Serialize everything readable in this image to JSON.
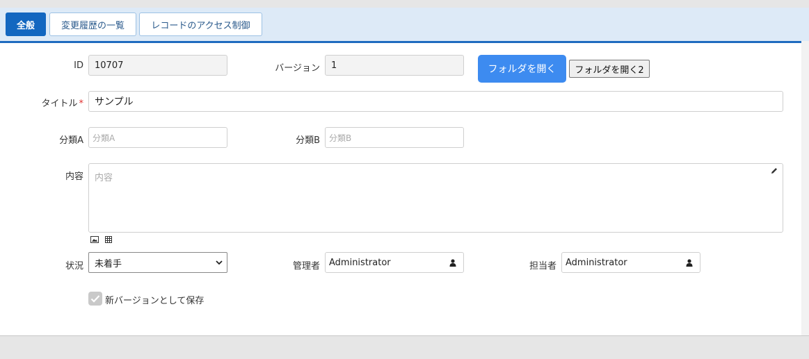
{
  "tabs": [
    {
      "label": "全般",
      "active": true
    },
    {
      "label": "変更履歴の一覧",
      "active": false
    },
    {
      "label": "レコードのアクセス制御",
      "active": false
    }
  ],
  "form": {
    "id": {
      "label": "ID",
      "value": "10707"
    },
    "version": {
      "label": "バージョン",
      "value": "1"
    },
    "open_folder_button": "フォルダを開く",
    "open_folder_button2": "フォルダを開く2",
    "title": {
      "label": "タイトル",
      "required_mark": "*",
      "value": "サンプル"
    },
    "class_a": {
      "label": "分類A",
      "placeholder": "分類A"
    },
    "class_b": {
      "label": "分類B",
      "placeholder": "分類B"
    },
    "body": {
      "label": "内容",
      "placeholder": "内容"
    },
    "status": {
      "label": "状況",
      "value": "未着手"
    },
    "manager": {
      "label": "管理者",
      "value": "Administrator"
    },
    "owner": {
      "label": "担当者",
      "value": "Administrator"
    },
    "save_as_new_version": {
      "label": "新バージョンとして保存",
      "checked": true
    }
  },
  "colors": {
    "accent": "#1367c0",
    "primary_button": "#3d8bf0",
    "required": "#e0302f"
  }
}
